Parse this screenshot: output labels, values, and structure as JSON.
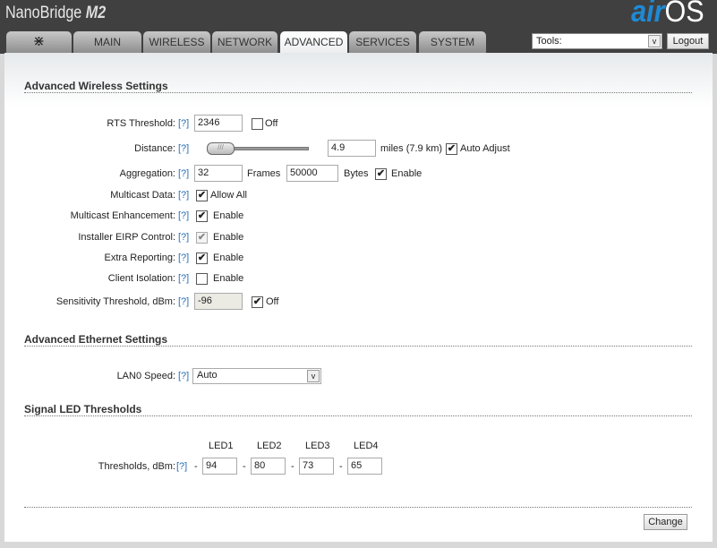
{
  "header": {
    "brand": "NanoBridge",
    "brand_model": "M2",
    "logo_air": "air",
    "logo_os": "OS"
  },
  "tabs": [
    {
      "label": ""
    },
    {
      "label": "MAIN"
    },
    {
      "label": "WIRELESS"
    },
    {
      "label": "NETWORK"
    },
    {
      "label": "ADVANCED"
    },
    {
      "label": "SERVICES"
    },
    {
      "label": "SYSTEM"
    }
  ],
  "tools": {
    "value": "Tools:",
    "arrow": "v"
  },
  "logout": "Logout",
  "help": "[?]",
  "wireless": {
    "title": "Advanced Wireless Settings",
    "rts": {
      "label": "RTS Threshold:",
      "value": "2346",
      "off_label": "Off",
      "off_checked": false
    },
    "distance": {
      "label": "Distance:",
      "value": "4.9",
      "units": "miles (7.9 km)",
      "auto_label": "Auto Adjust",
      "auto_checked": true,
      "slider_fraction": 0.1
    },
    "aggregation": {
      "label": "Aggregation:",
      "frames": "32",
      "frames_label": "Frames",
      "bytes": "50000",
      "bytes_label": "Bytes",
      "enable_label": "Enable",
      "enabled": true
    },
    "multicast_data": {
      "label": "Multicast Data:",
      "option": "Allow All",
      "checked": true
    },
    "multicast_enh": {
      "label": "Multicast Enhancement:",
      "option": "Enable",
      "checked": true
    },
    "eirp": {
      "label": "Installer EIRP Control:",
      "option": "Enable",
      "checked": true
    },
    "extra": {
      "label": "Extra Reporting:",
      "option": "Enable",
      "checked": true
    },
    "isolation": {
      "label": "Client Isolation:",
      "option": "Enable",
      "checked": false
    },
    "sensitivity": {
      "label": "Sensitivity Threshold, dBm:",
      "value": "-96",
      "off_label": "Off",
      "off_checked": true
    }
  },
  "ethernet": {
    "title": "Advanced Ethernet Settings",
    "lan_label": "LAN0 Speed:",
    "lan_value": "Auto"
  },
  "led": {
    "title": "Signal LED Thresholds",
    "headers": [
      "LED1",
      "LED2",
      "LED3",
      "LED4"
    ],
    "label": "Thresholds, dBm:",
    "dash": "-",
    "values": [
      "94",
      "80",
      "73",
      "65"
    ]
  },
  "change": "Change",
  "check": "✔"
}
